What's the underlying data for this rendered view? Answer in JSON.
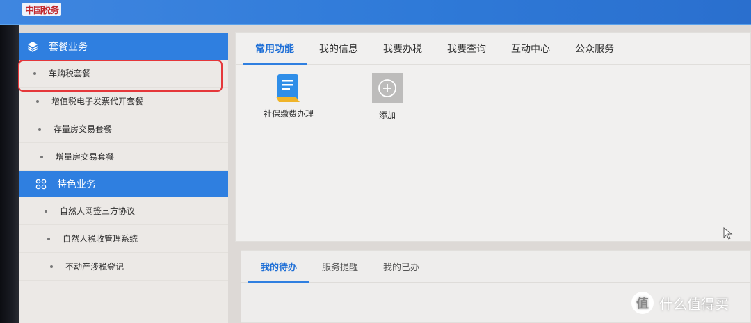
{
  "header": {
    "logo_text": "中国税务"
  },
  "sidebar": {
    "sections": [
      {
        "title": "套餐业务",
        "icon": "layers-icon",
        "items": [
          "车购税套餐",
          "增值税电子发票代开套餐",
          "存量房交易套餐",
          "增量房交易套餐"
        ]
      },
      {
        "title": "特色业务",
        "icon": "grid-circles-icon",
        "items": [
          "自然人网签三方协议",
          "自然人税收管理系统",
          "不动产涉税登记"
        ]
      }
    ],
    "selected_item": "车购税套餐"
  },
  "main": {
    "tabs": [
      "常用功能",
      "我的信息",
      "我要办税",
      "我要查询",
      "互动中心",
      "公众服务"
    ],
    "active_tab": "常用功能",
    "functions": [
      {
        "label": "社保缴费办理",
        "icon": "document-icon"
      },
      {
        "label": "添加",
        "icon": "plus-circle-icon"
      }
    ]
  },
  "bottom": {
    "tabs": [
      "我的待办",
      "服务提醒",
      "我的已办"
    ],
    "active_tab": "我的待办"
  },
  "watermark": {
    "text": "什么值得买",
    "badge": "值"
  },
  "colors": {
    "accent": "#2f7fe0",
    "highlight_border": "#e5373a"
  }
}
